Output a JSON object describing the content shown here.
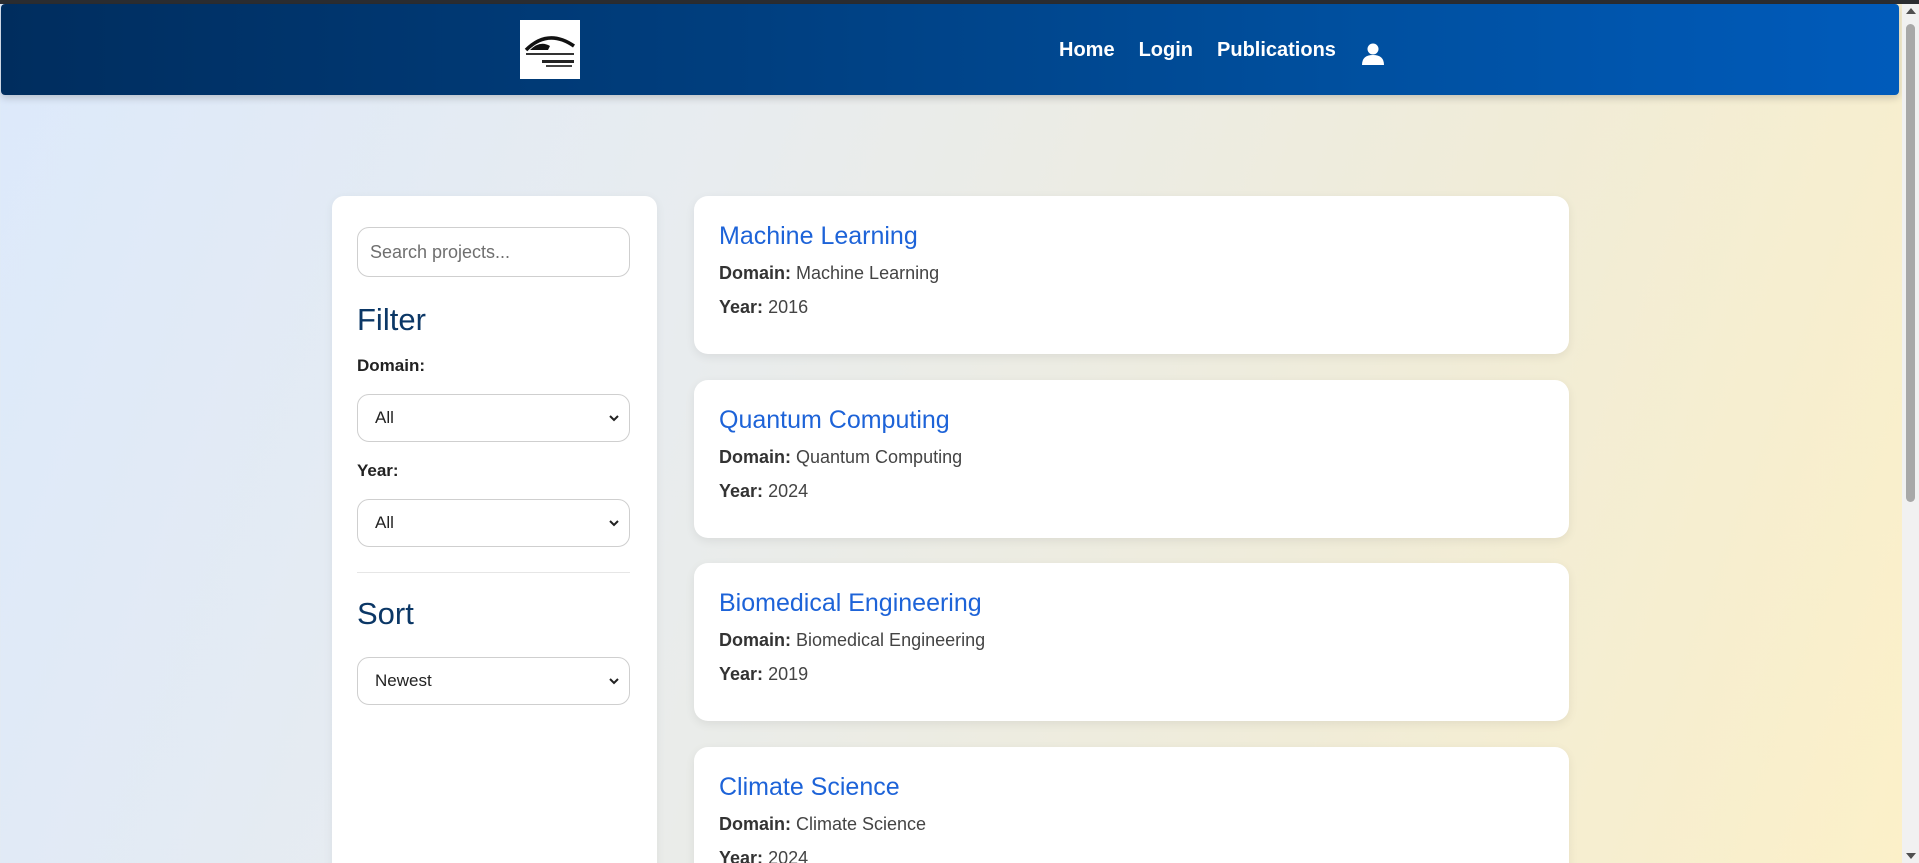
{
  "navbar": {
    "logo_alt": "University logo",
    "links": [
      {
        "label": "Home"
      },
      {
        "label": "Login"
      },
      {
        "label": "Publications"
      }
    ],
    "user_icon": "user-icon"
  },
  "sidebar": {
    "search": {
      "placeholder": "Search projects...",
      "value": ""
    },
    "filter_title": "Filter",
    "domain_label": "Domain:",
    "domain_value": "All",
    "year_label": "Year:",
    "year_value": "All",
    "sort_title": "Sort",
    "sort_value": "Newest"
  },
  "labels": {
    "domain": "Domain:",
    "year": "Year:"
  },
  "projects": [
    {
      "title": "Machine Learning",
      "domain": "Machine Learning",
      "year": "2016"
    },
    {
      "title": "Quantum Computing",
      "domain": "Quantum Computing",
      "year": "2024"
    },
    {
      "title": "Biomedical Engineering",
      "domain": "Biomedical Engineering",
      "year": "2019"
    },
    {
      "title": "Climate Science",
      "domain": "Climate Science",
      "year": "2024"
    }
  ],
  "colors": {
    "navbar_start": "#002d5e",
    "navbar_end": "#005bbb",
    "link_blue": "#1d63d8",
    "heading_navy": "#0b3766"
  }
}
